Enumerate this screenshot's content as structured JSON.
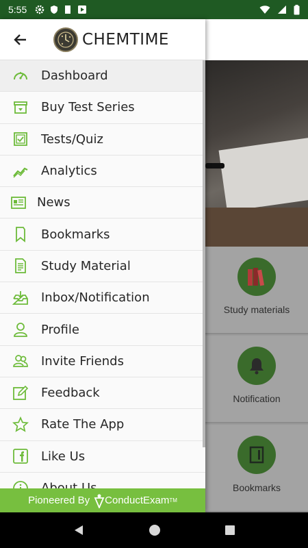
{
  "status_bar": {
    "time": "5:55"
  },
  "app": {
    "title": "CHEMTIME"
  },
  "menu": {
    "items": [
      {
        "label": "Dashboard",
        "icon": "speedometer-icon"
      },
      {
        "label": "Buy Test Series",
        "icon": "shop-icon"
      },
      {
        "label": "Tests/Quiz",
        "icon": "checklist-icon"
      },
      {
        "label": "Analytics",
        "icon": "chart-line-icon"
      },
      {
        "label": "News",
        "icon": "newspaper-icon"
      },
      {
        "label": "Bookmarks",
        "icon": "bookmark-icon"
      },
      {
        "label": "Study Material",
        "icon": "document-icon"
      },
      {
        "label": "Inbox/Notification",
        "icon": "inbox-icon"
      },
      {
        "label": "Profile",
        "icon": "person-icon"
      },
      {
        "label": "Invite Friends",
        "icon": "people-icon"
      },
      {
        "label": "Feedback",
        "icon": "edit-icon"
      },
      {
        "label": "Rate The App",
        "icon": "star-icon"
      },
      {
        "label": "Like Us",
        "icon": "facebook-icon"
      },
      {
        "label": "About Us",
        "icon": "info-icon"
      }
    ]
  },
  "footer": {
    "prefix": "Pioneered By",
    "brand": "ConductExam",
    "trademark": "TM"
  },
  "background": {
    "tiles": [
      {
        "label": "Study materials"
      },
      {
        "label": "Notification"
      },
      {
        "label": "Bookmarks"
      }
    ]
  },
  "colors": {
    "accent": "#77bf3f",
    "icon_green": "#6dbb3a",
    "status_bar": "#1f5a23"
  }
}
